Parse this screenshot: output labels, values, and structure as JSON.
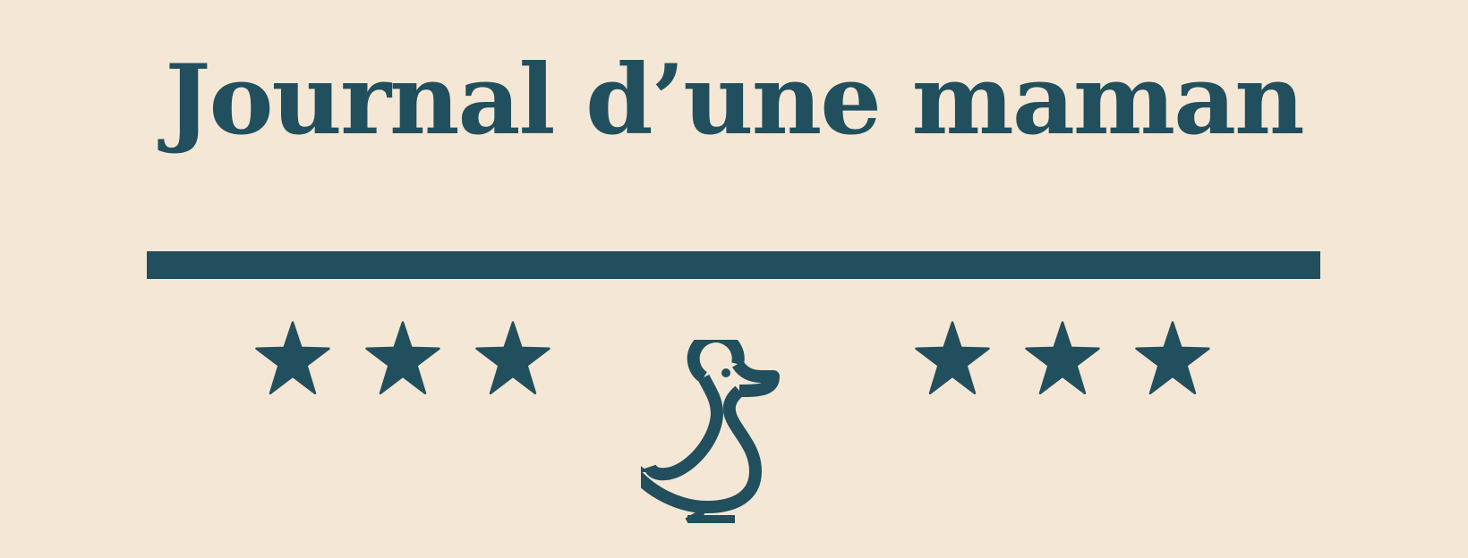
{
  "title": "Journal d’une maman",
  "colors": {
    "background": "#f5e7d5",
    "primary": "#214f5d"
  },
  "decorations": {
    "left_stars": [
      "star-icon",
      "star-icon",
      "star-icon"
    ],
    "right_stars": [
      "star-icon",
      "star-icon",
      "star-icon"
    ],
    "center_icon": "duck-icon"
  }
}
